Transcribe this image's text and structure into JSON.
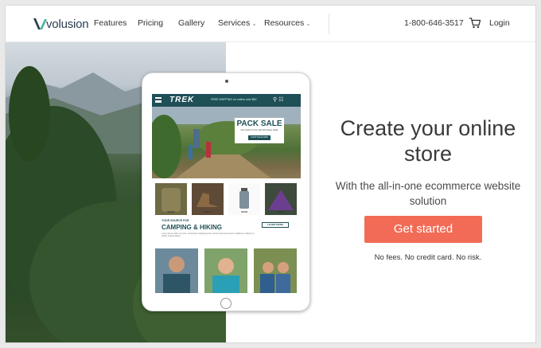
{
  "brand": {
    "logo_text": "volusion",
    "accent": "#f26b56",
    "dark_teal": "#1f4f57"
  },
  "nav": {
    "items": [
      {
        "label": "Features",
        "has_dropdown": false
      },
      {
        "label": "Pricing",
        "has_dropdown": false
      },
      {
        "label": "Gallery",
        "has_dropdown": false
      },
      {
        "label": "Services",
        "has_dropdown": true
      },
      {
        "label": "Resources",
        "has_dropdown": true
      }
    ],
    "phone": "1-800-646-3517",
    "cart_icon": "shopping-cart-icon",
    "login_label": "Login"
  },
  "tablet_screen": {
    "store_logo": "TREK",
    "shipping_text": "FREE SHIPPING on orders over $50",
    "promo_title": "PACK SALE",
    "promo_subtitle": "Get ready for the trail with these deals",
    "promo_button": "SHOP SALE NOW",
    "products": [
      "PACKS",
      "BOOTS",
      "GEAR",
      "TENTS"
    ],
    "section_kicker": "YOUR SOURCE FOR",
    "section_title": "CAMPING & HIKING",
    "section_body": "Lorem ipsum dolor sit amet, consectetur adipiscing elit, sed do eiusmod tempor incididunt ut labore et dolore magna aliqua.",
    "learn_more": "LEARN MORE"
  },
  "hero": {
    "headline": "Create your online store",
    "subheadline": "With the all-in-one ecommerce website solution",
    "cta_label": "Get started",
    "fine_print": "No fees. No credit card. No risk."
  }
}
